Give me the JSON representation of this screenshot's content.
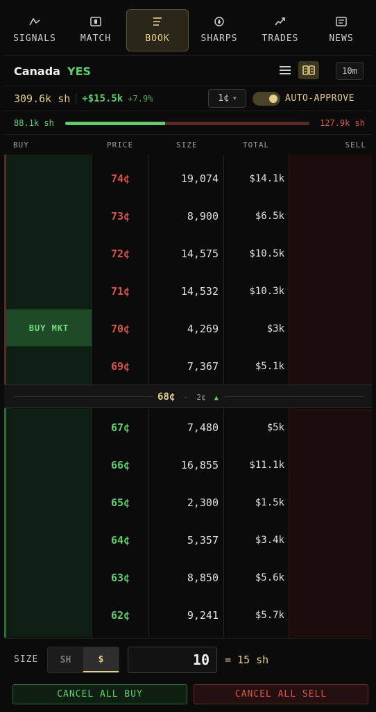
{
  "nav": {
    "tabs": [
      {
        "label": "SIGNALS",
        "icon": "signal-line-icon"
      },
      {
        "label": "MATCH",
        "icon": "match-icon"
      },
      {
        "label": "BOOK",
        "icon": "book-icon",
        "active": true
      },
      {
        "label": "SHARPS",
        "icon": "sharps-icon"
      },
      {
        "label": "TRADES",
        "icon": "trend-icon"
      },
      {
        "label": "NEWS",
        "icon": "news-icon"
      }
    ]
  },
  "market": {
    "name": "Canada",
    "side": "YES",
    "time_window": "10m"
  },
  "position": {
    "shares": "309.6k sh",
    "pnl": "+$15.5k",
    "pnl_pct": "+7.9%",
    "tick": "1¢",
    "auto_approve_label": "AUTO-APPROVE",
    "auto_approve_on": true
  },
  "depth": {
    "buy": "88.1k sh",
    "sell": "127.9k sh",
    "buy_fraction": 0.408
  },
  "columns": {
    "buy": "BUY",
    "price": "PRICE",
    "size": "SIZE",
    "total": "TOTAL",
    "sell": "SELL"
  },
  "asks": [
    {
      "price": "74¢",
      "size": "19,074",
      "total": "$14.1k"
    },
    {
      "price": "73¢",
      "size": "8,900",
      "total": "$6.5k"
    },
    {
      "price": "72¢",
      "size": "14,575",
      "total": "$10.5k"
    },
    {
      "price": "71¢",
      "size": "14,532",
      "total": "$10.3k"
    },
    {
      "price": "70¢",
      "size": "4,269",
      "total": "$3k"
    },
    {
      "price": "69¢",
      "size": "7,367",
      "total": "$5.1k"
    }
  ],
  "buy_market_label": "BUY MKT",
  "spread": {
    "mid": "68¢",
    "spread": "2¢",
    "arrow": "▲"
  },
  "bids": [
    {
      "price": "67¢",
      "size": "7,480",
      "total": "$5k"
    },
    {
      "price": "66¢",
      "size": "16,855",
      "total": "$11.1k"
    },
    {
      "price": "65¢",
      "size": "2,300",
      "total": "$1.5k"
    },
    {
      "price": "64¢",
      "size": "5,357",
      "total": "$3.4k"
    },
    {
      "price": "63¢",
      "size": "8,850",
      "total": "$5.6k"
    },
    {
      "price": "62¢",
      "size": "9,241",
      "total": "$5.7k"
    }
  ],
  "order": {
    "size_label": "SIZE",
    "unit_shares": "SH",
    "unit_dollars": "$",
    "selected_unit": "$",
    "amount": "10",
    "equivalent": "= 15 sh"
  },
  "actions": {
    "cancel_buy": "CANCEL ALL BUY",
    "cancel_sell": "CANCEL ALL SELL"
  },
  "colors": {
    "accent": "#e6cf8a",
    "buy": "#5fcf6c",
    "sell": "#d9574a",
    "background": "#0b0b0b"
  }
}
